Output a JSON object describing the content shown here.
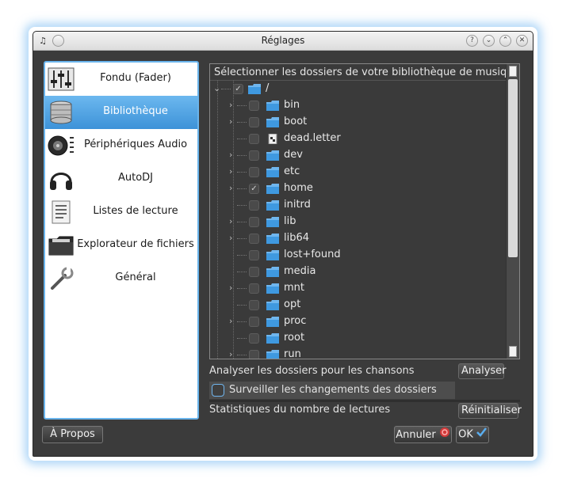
{
  "window": {
    "title": "Réglages",
    "controls": [
      "help-icon",
      "minimize-icon",
      "maximize-icon",
      "close-icon"
    ]
  },
  "sidebar": {
    "items": [
      {
        "label": "Fondu (Fader)",
        "icon": "fader-icon",
        "selected": false
      },
      {
        "label": "Bibliothèque",
        "icon": "database-icon",
        "selected": true
      },
      {
        "label": "Périphériques Audio",
        "icon": "speaker-icon",
        "selected": false
      },
      {
        "label": "AutoDJ",
        "icon": "headphones-icon",
        "selected": false
      },
      {
        "label": "Listes de lecture",
        "icon": "playlist-icon",
        "selected": false
      },
      {
        "label": "Explorateur de fichiers",
        "icon": "folder-browser-icon",
        "selected": false
      },
      {
        "label": "Général",
        "icon": "wrench-icon",
        "selected": false
      }
    ]
  },
  "tree": {
    "header": "Sélectionner les dossiers de votre bibliothèque de musique",
    "root": {
      "name": "/",
      "checked": true
    },
    "rows": [
      {
        "name": "bin",
        "expandable": true,
        "checked": false,
        "type": "folder"
      },
      {
        "name": "boot",
        "expandable": true,
        "checked": false,
        "type": "folder"
      },
      {
        "name": "dead.letter",
        "expandable": false,
        "checked": false,
        "type": "file"
      },
      {
        "name": "dev",
        "expandable": true,
        "checked": false,
        "type": "folder"
      },
      {
        "name": "etc",
        "expandable": true,
        "checked": false,
        "type": "folder"
      },
      {
        "name": "home",
        "expandable": true,
        "checked": true,
        "type": "folder"
      },
      {
        "name": "initrd",
        "expandable": false,
        "checked": false,
        "type": "folder"
      },
      {
        "name": "lib",
        "expandable": true,
        "checked": false,
        "type": "folder"
      },
      {
        "name": "lib64",
        "expandable": true,
        "checked": false,
        "type": "folder"
      },
      {
        "name": "lost+found",
        "expandable": false,
        "checked": false,
        "type": "folder"
      },
      {
        "name": "media",
        "expandable": false,
        "checked": false,
        "type": "folder"
      },
      {
        "name": "mnt",
        "expandable": true,
        "checked": false,
        "type": "folder"
      },
      {
        "name": "opt",
        "expandable": false,
        "checked": false,
        "type": "folder"
      },
      {
        "name": "proc",
        "expandable": true,
        "checked": false,
        "type": "folder"
      },
      {
        "name": "root",
        "expandable": false,
        "checked": false,
        "type": "folder"
      },
      {
        "name": "run",
        "expandable": true,
        "checked": false,
        "type": "folder"
      }
    ]
  },
  "options": {
    "scan_label": "Analyser les dossiers pour les chansons",
    "scan_button": "Analyser",
    "watch_label": "Surveiller les changements des dossiers",
    "watch_checked": false,
    "stats_label": "Statistiques du nombre de lectures",
    "reset_button": "Réinitialiser"
  },
  "footer": {
    "about_button": "À Propos",
    "cancel_button": "Annuler",
    "ok_button": "OK"
  },
  "colors": {
    "accent": "#4aa3e6",
    "window_bg": "#3b3b3b",
    "folder": "#6fb6ee"
  }
}
